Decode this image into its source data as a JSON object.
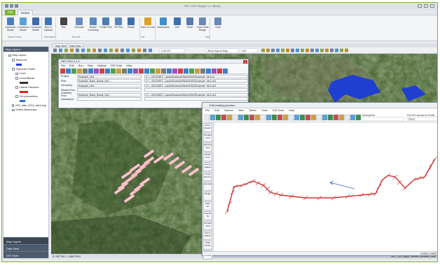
{
  "app": {
    "title": "HEC-RAS Mapper 1.0 (Beta)",
    "tabs": [
      "File",
      "Home"
    ]
  },
  "ribbon": {
    "buttons": [
      {
        "label": "Hydraulic Model",
        "icon": "model-icon",
        "color": "#4a7fc1"
      },
      {
        "label": "Conditions Model",
        "icon": "conditions-icon",
        "color": "#5aa0d8"
      },
      {
        "label": "Compose Model",
        "icon": "compose-icon",
        "color": "#4169a8"
      },
      {
        "label": "Run to Hydraul",
        "icon": "run-icon",
        "color": "#3e72b8"
      },
      {
        "label": "Run",
        "icon": "runner-icon",
        "color": "#444444"
      },
      {
        "label": "Animate",
        "icon": "animate-icon",
        "color": "#6a8bc4"
      },
      {
        "label": "Reach Summary",
        "icon": "summary-icon",
        "color": "#5a89c0"
      },
      {
        "label": "Profile Plot",
        "icon": "profile-icon",
        "color": "#4b7cb5"
      },
      {
        "label": "XS Plot",
        "icon": "xs-icon",
        "color": "#5186c0"
      },
      {
        "label": "Result",
        "icon": "result-icon",
        "color": "#3f6fae"
      },
      {
        "label": "Save & Lock",
        "icon": "lock-icon",
        "color": "#e0a020"
      },
      {
        "label": "Dashboard",
        "icon": "dashboard-icon",
        "color": "#3b8fd0"
      },
      {
        "label": "Info",
        "icon": "info-icon",
        "color": "#3b6fb0"
      },
      {
        "label": "Clear",
        "icon": "clear-icon",
        "color": "#5a7ab0"
      },
      {
        "label": "Clear Data Range",
        "icon": "range-icon",
        "color": "#6a88b8"
      },
      {
        "label": "Help",
        "icon": "help-icon",
        "color": "#6a88b8"
      }
    ],
    "groups": [
      "Model Setup",
      "Simulation",
      "Results",
      "Lock",
      "Help"
    ]
  },
  "sidebar": {
    "header": "Map Layers",
    "items": [
      {
        "label": "Map Layers",
        "level": 0,
        "expanded": true
      },
      {
        "label": "Reservoir",
        "level": 1,
        "swatch": "#1f3fd0"
      },
      {
        "label": "Hydraulic Profile",
        "level": 1
      },
      {
        "label": "Level",
        "level": 2
      },
      {
        "label": "Levee/Banks",
        "level": 2,
        "swatch": "#333333"
      },
      {
        "label": "Lateral Structure",
        "level": 2,
        "swatch": "#e02020"
      },
      {
        "label": "SA connections",
        "level": 2,
        "swatch": "#3070e0"
      },
      {
        "label": "GIS_data_2016_ditch.shp",
        "level": 1
      },
      {
        "label": "Online Basemaps",
        "level": 1
      }
    ],
    "footer": [
      "Map Layers",
      "Data View",
      "GIS Tools"
    ]
  },
  "map": {
    "tabs": [
      "Map View",
      "Data View"
    ],
    "coordinates": "0.00137",
    "basemap": "Bing Hybrid Map",
    "zoom": "100"
  },
  "dialog1": {
    "title": "HEC-RAS 4.1.0",
    "menu": [
      "File",
      "Edit",
      "Run",
      "View",
      "Options",
      "GIS Tools",
      "Help"
    ],
    "fields": [
      {
        "key": "Project:",
        "val1": "Example_hin1",
        "val2": "C:\\...\\2013\\HEC_Lands\\Example\\Work\\RAS\\Example_hin1.prj"
      },
      {
        "key": "Plan:",
        "val1": "Example_Bank_Break_hin1",
        "val2": "C:\\...\\2013\\HEC_Lands\\Example\\Work\\RAS\\Example_hin1.p01"
      },
      {
        "key": "Geometry:",
        "val1": "Example_hin1",
        "val2": "C:\\...\\2013\\HEC_Lands\\Example\\Work\\RAS\\Example_hin1.g01"
      },
      {
        "key": "Steady Flow:",
        "val1": "",
        "val2": ""
      },
      {
        "key": "Unsteady Flow:",
        "val1": "Example_Bank_Break_hin1",
        "val2": "C:\\...\\2013\\HEC_Lands\\Example\\Work\\RAS\\Example_hin1.u01"
      },
      {
        "key": "Description:",
        "val1": "",
        "val2": ""
      }
    ]
  },
  "dialog2": {
    "title": "Edit existing junction",
    "menu": [
      "File",
      "Edit",
      "Options",
      "View",
      "Tables",
      "Tools",
      "GIS Tools",
      "Help"
    ],
    "description_label": "Description:",
    "reach_label": "Plot GIS access for Profile",
    "river_select": "Dered",
    "left_tools": [
      "River Reach",
      "Storage Area",
      "2D Flow Area",
      "SA/2D Conn",
      "Pump Station",
      "Cross Section",
      "Junction",
      "Bridge",
      "Inline Str",
      "Lateral Str",
      "Storage Area",
      "Pump Station",
      "HTab Param",
      "View Picture"
    ],
    "status_left": "",
    "status_right": "0.0000, 0.0000"
  },
  "statusbar": {
    "left": "5 / 587760.1 / 1881749.8",
    "right": "HEC_GIS_Apps_Version_Bratillia_Zone"
  },
  "colors": {
    "accent": "#7cb32f",
    "reach": "#d03030",
    "flow_arrow": "#4a63c8",
    "water": "#1f3fd0"
  }
}
